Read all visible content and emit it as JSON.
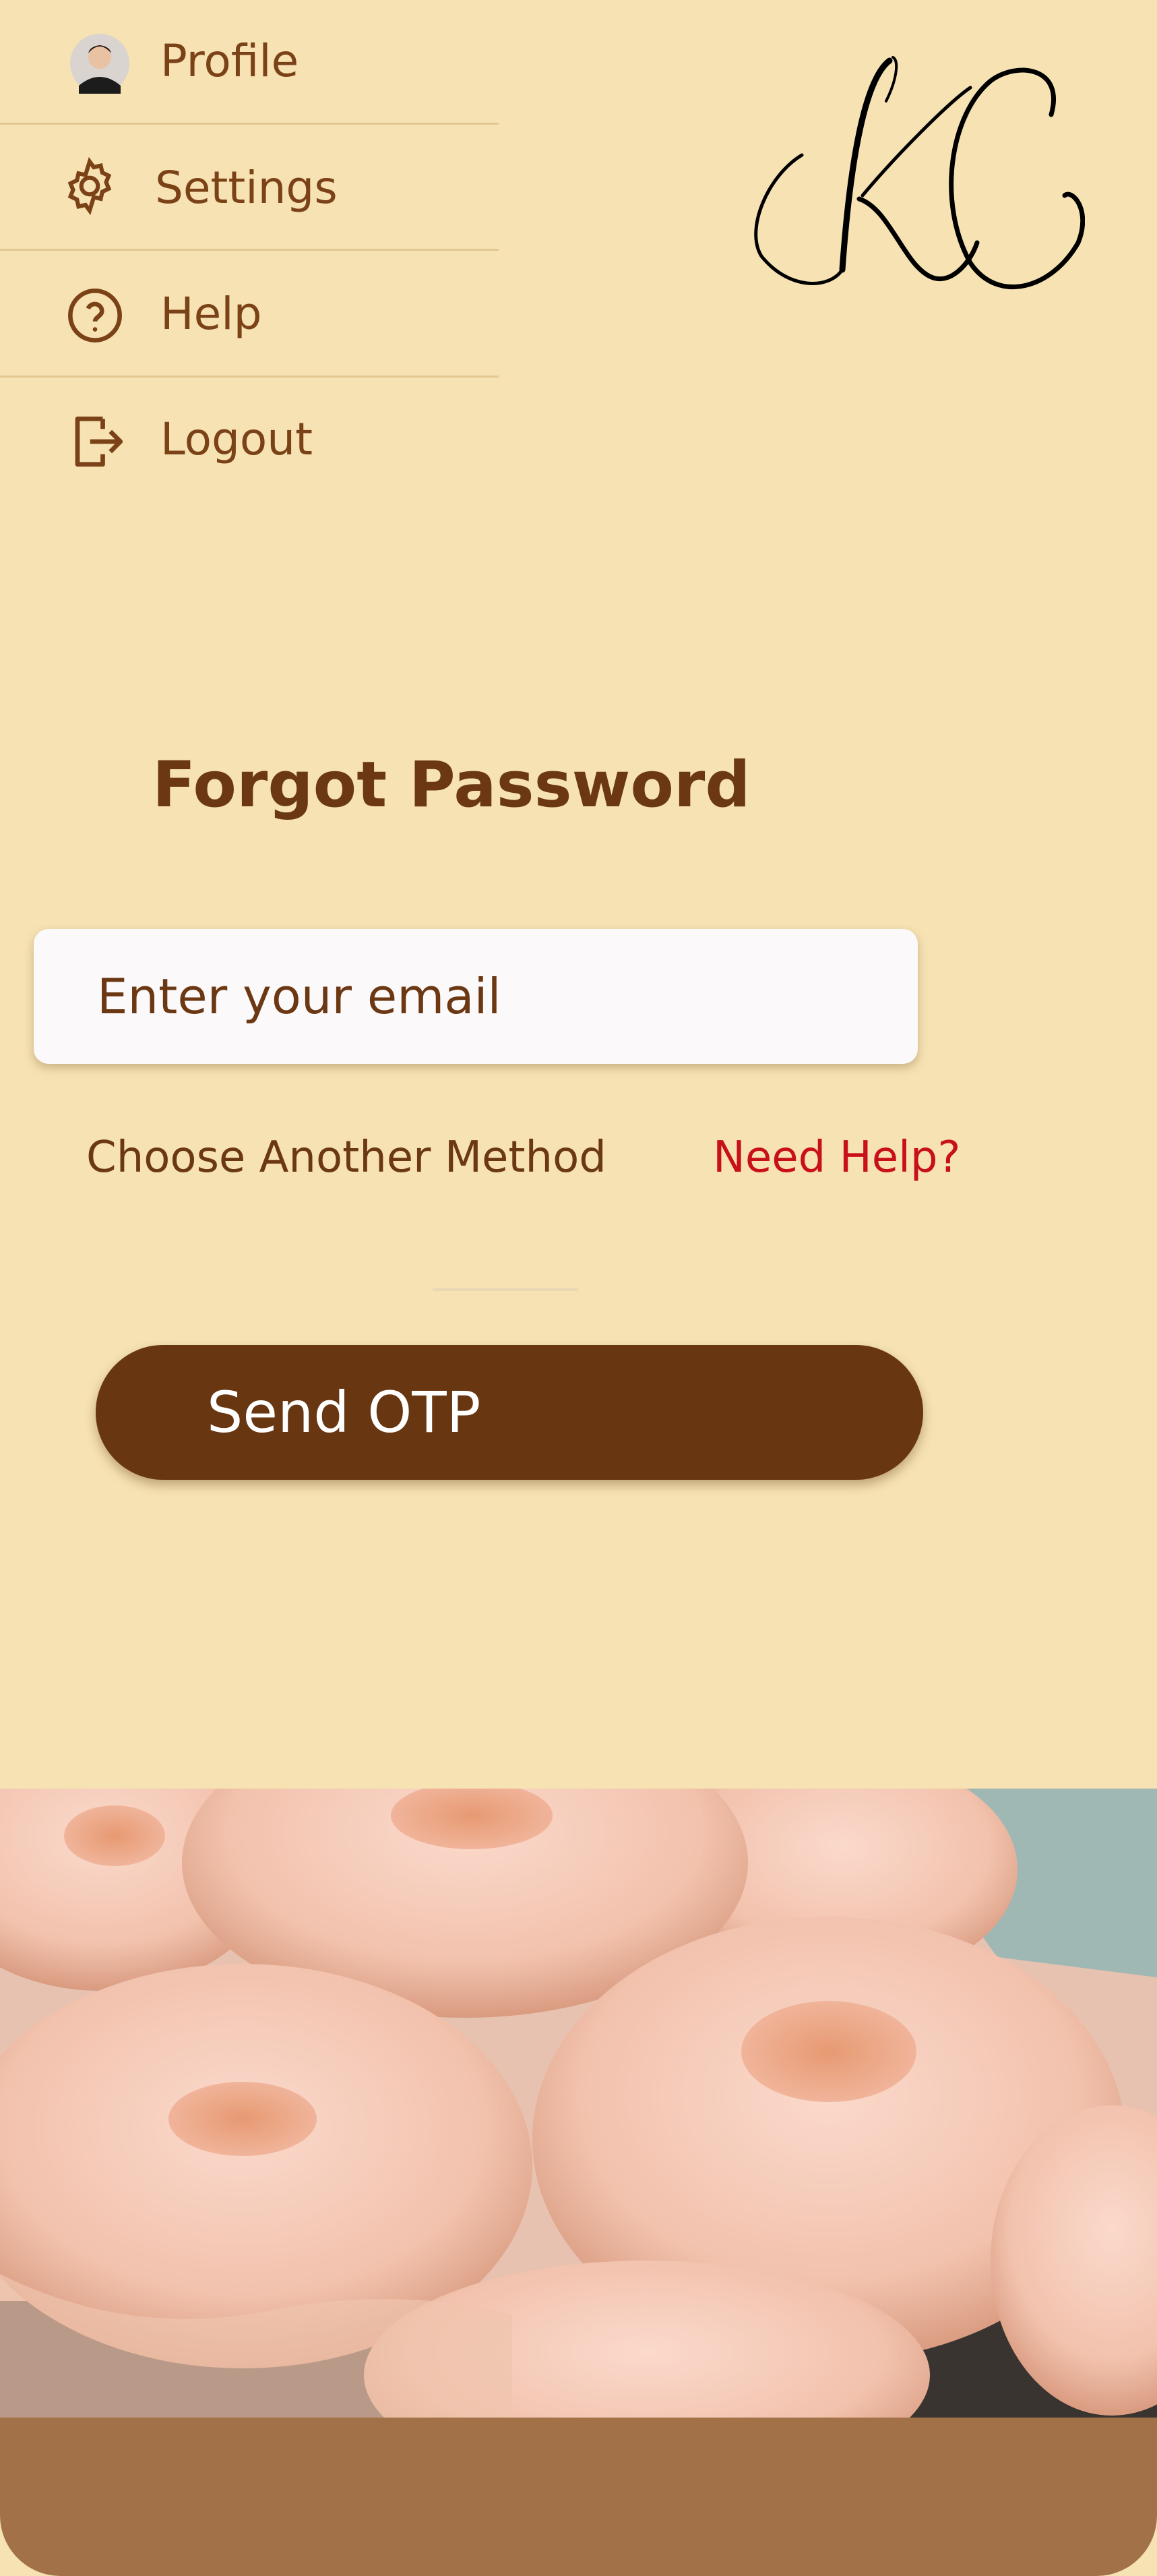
{
  "menu": {
    "items": [
      {
        "label": "Profile",
        "icon": "avatar"
      },
      {
        "label": "Settings",
        "icon": "gear-icon"
      },
      {
        "label": "Help",
        "icon": "help-circle-icon"
      },
      {
        "label": "Logout",
        "icon": "logout-icon"
      }
    ]
  },
  "logo": {
    "text": "KC"
  },
  "page": {
    "title": "Forgot Password"
  },
  "form": {
    "email_placeholder": "Enter your email",
    "choose_method": "Choose Another Method",
    "need_help": "Need Help?",
    "send_button": "Send OTP"
  },
  "colors": {
    "background": "#f6e2b3",
    "primary": "#693612",
    "text": "#6b3813",
    "alert": "#c8101a",
    "footer": "#a27148"
  }
}
